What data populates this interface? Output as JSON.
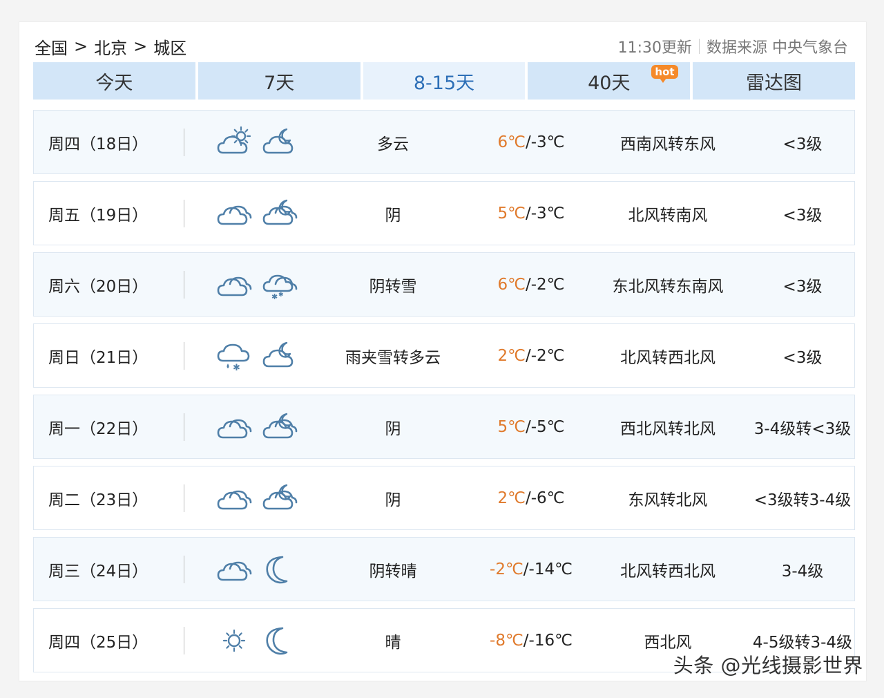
{
  "breadcrumb": {
    "items": [
      "全国",
      "北京",
      "城区"
    ],
    "separator": ">"
  },
  "source": {
    "updated": "11:30更新",
    "text": "数据来源 中央气象台"
  },
  "tabs": [
    {
      "label": "今天",
      "active": false
    },
    {
      "label": "7天",
      "active": false
    },
    {
      "label": "8-15天",
      "active": true
    },
    {
      "label": "40天",
      "active": false,
      "badge": "hot"
    },
    {
      "label": "雷达图",
      "active": false
    }
  ],
  "colors": {
    "accent": "#2d6fb7",
    "high_temp": "#e07a2c",
    "tab_bg": "#d3e6f8",
    "icon": "#4f7fa8"
  },
  "forecast": [
    {
      "date": "周四（18日）",
      "day_icon": "partly-cloudy-sun-icon",
      "night_icon": "cloud-moon-icon",
      "desc": "多云",
      "high": "6℃",
      "low": "/-3℃",
      "wind": "西南风转东风",
      "level": "<3级"
    },
    {
      "date": "周五（19日）",
      "day_icon": "overcast-cloud-icon",
      "night_icon": "overcast-moon-icon",
      "desc": "阴",
      "high": "5℃",
      "low": "/-3℃",
      "wind": "北风转南风",
      "level": "<3级"
    },
    {
      "date": "周六（20日）",
      "day_icon": "overcast-cloud-icon",
      "night_icon": "snow-cloud-icon",
      "desc": "阴转雪",
      "high": "6℃",
      "low": "/-2℃",
      "wind": "东北风转东南风",
      "level": "<3级"
    },
    {
      "date": "周日（21日）",
      "day_icon": "sleet-cloud-icon",
      "night_icon": "cloud-moon-icon",
      "desc": "雨夹雪转多云",
      "high": "2℃",
      "low": "/-2℃",
      "wind": "北风转西北风",
      "level": "<3级"
    },
    {
      "date": "周一（22日）",
      "day_icon": "overcast-cloud-icon",
      "night_icon": "overcast-moon-icon",
      "desc": "阴",
      "high": "5℃",
      "low": "/-5℃",
      "wind": "西北风转北风",
      "level": "3-4级转<3级"
    },
    {
      "date": "周二（23日）",
      "day_icon": "overcast-cloud-icon",
      "night_icon": "overcast-moon-icon",
      "desc": "阴",
      "high": "2℃",
      "low": "/-6℃",
      "wind": "东风转北风",
      "level": "<3级转3-4级"
    },
    {
      "date": "周三（24日）",
      "day_icon": "overcast-cloud-icon",
      "night_icon": "moon-icon",
      "desc": "阴转晴",
      "high": "-2℃",
      "low": "/-14℃",
      "wind": "北风转西北风",
      "level": "3-4级"
    },
    {
      "date": "周四（25日）",
      "day_icon": "sun-icon",
      "night_icon": "moon-icon",
      "desc": "晴",
      "high": "-8℃",
      "low": "/-16℃",
      "wind": "西北风",
      "level": "4-5级转3-4级"
    }
  ],
  "watermark": "头条 @光线摄影世界"
}
